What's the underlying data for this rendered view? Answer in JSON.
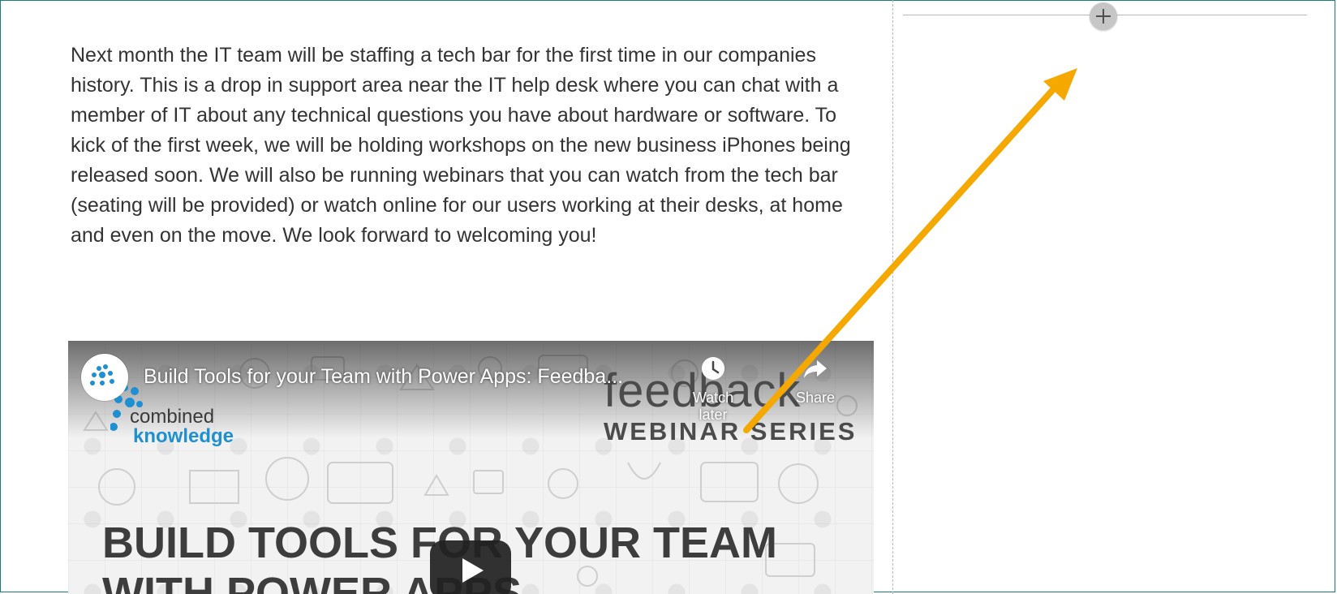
{
  "article": {
    "body": "Next month the IT team will be staffing a tech bar for the first time in our companies history. This is a drop in support area near the IT help desk where you can chat with a member of IT about any technical questions you have about hardware or software. To kick of the first week, we will be holding workshops on the new business iPhones being released soon. We will also be running webinars that you can watch from the tech bar (seating will be provided) or watch online for our users working at their desks, at home and even on the move. We look forward to welcoming you!"
  },
  "video": {
    "title": "Build Tools for your Team with Power Apps: Feedba...",
    "watch_later_label": "Watch later",
    "share_label": "Share",
    "thumbnail": {
      "brand_line1": "combined",
      "brand_line2": "knowledge",
      "feedback_word": "feedback",
      "series_label": "WEBINAR SERIES",
      "headline_line1": "BUILD TOOLS FOR YOUR TEAM",
      "headline_line2": "WITH POWER APPS"
    },
    "icons": {
      "play": "play-icon",
      "watch_later": "clock-icon",
      "share": "share-arrow-icon"
    }
  },
  "canvas": {
    "add_section_icon": "plus-icon"
  },
  "colors": {
    "frame_border": "#1a7f7a",
    "annotation_arrow": "#f5a800",
    "brand_blue": "#1e8fd2",
    "text": "#333333"
  }
}
